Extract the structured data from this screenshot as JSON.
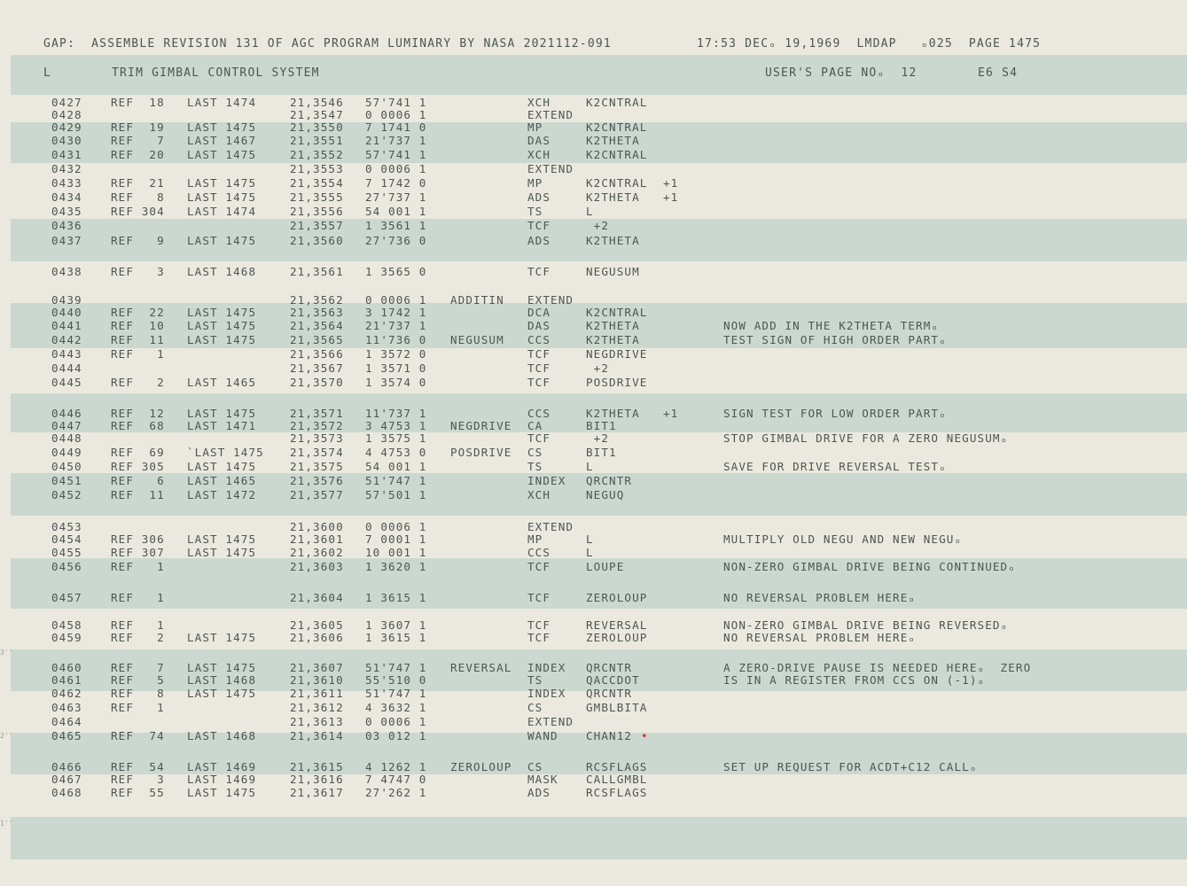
{
  "header": {
    "left": "GAP:  ASSEMBLE REVISION 131 OF AGC PROGRAM LUMINARY BY NASA 2021112-091",
    "right": "17:53 DECₒ 19,1969  LMDAP   ₒ025  PAGE 1475"
  },
  "subheader": {
    "letter": "L",
    "title": "TRIM GIMBAL CONTROL SYSTEM",
    "users_page": "USER'S PAGE NOₒ  12",
    "tag": "E6 S4"
  },
  "rows": [
    {
      "ln": "0427",
      "ref": "REF  18",
      "last": "LAST 1474",
      "addr": "21,3546",
      "oct": "57'741 1",
      "lbl": "",
      "op": "XCH",
      "arg": "K2CNTRAL",
      "mod": "",
      "cmt": ""
    },
    {
      "ln": "0428",
      "ref": "",
      "last": "",
      "addr": "21,3547",
      "oct": "0 0006 1",
      "lbl": "",
      "op": "EXTEND",
      "arg": "",
      "mod": "",
      "cmt": ""
    },
    {
      "ln": "0429",
      "ref": "REF  19",
      "last": "LAST 1475",
      "addr": "21,3550",
      "oct": "7 1741 0",
      "lbl": "",
      "op": "MP",
      "arg": "K2CNTRAL",
      "mod": "",
      "cmt": ""
    },
    {
      "ln": "0430",
      "ref": "REF   7",
      "last": "LAST 1467",
      "addr": "21,3551",
      "oct": "21'737 1",
      "lbl": "",
      "op": "DAS",
      "arg": "K2THETA",
      "mod": "",
      "cmt": ""
    },
    {
      "ln": "0431",
      "ref": "REF  20",
      "last": "LAST 1475",
      "addr": "21,3552",
      "oct": "57'741 1",
      "lbl": "",
      "op": "XCH",
      "arg": "K2CNTRAL",
      "mod": "",
      "cmt": ""
    },
    {
      "ln": "0432",
      "ref": "",
      "last": "",
      "addr": "21,3553",
      "oct": "0 0006 1",
      "lbl": "",
      "op": "EXTEND",
      "arg": "",
      "mod": "",
      "cmt": ""
    },
    {
      "ln": "0433",
      "ref": "REF  21",
      "last": "LAST 1475",
      "addr": "21,3554",
      "oct": "7 1742 0",
      "lbl": "",
      "op": "MP",
      "arg": "K2CNTRAL",
      "mod": "+1",
      "cmt": ""
    },
    {
      "ln": "0434",
      "ref": "REF   8",
      "last": "LAST 1475",
      "addr": "21,3555",
      "oct": "27'737 1",
      "lbl": "",
      "op": "ADS",
      "arg": "K2THETA",
      "mod": "+1",
      "cmt": ""
    },
    {
      "ln": "0435",
      "ref": "REF 304",
      "last": "LAST 1474",
      "addr": "21,3556",
      "oct": "54 001 1",
      "lbl": "",
      "op": "TS",
      "arg": "L",
      "mod": "",
      "cmt": ""
    },
    {
      "ln": "0436",
      "ref": "",
      "last": "",
      "addr": "21,3557",
      "oct": "1 3561 1",
      "lbl": "",
      "op": "TCF",
      "arg": " +2",
      "mod": "",
      "cmt": ""
    },
    {
      "ln": "0437",
      "ref": "REF   9",
      "last": "LAST 1475",
      "addr": "21,3560",
      "oct": "27'736 0",
      "lbl": "",
      "op": "ADS",
      "arg": "K2THETA",
      "mod": "",
      "cmt": ""
    },
    {
      "ln": "0438",
      "ref": "REF   3",
      "last": "LAST 1468",
      "addr": "21,3561",
      "oct": "1 3565 0",
      "lbl": "",
      "op": "TCF",
      "arg": "NEGUSUM",
      "mod": "",
      "cmt": ""
    },
    {
      "ln": "0439",
      "ref": "",
      "last": "",
      "addr": "21,3562",
      "oct": "0 0006 1",
      "lbl": "ADDITIN",
      "op": "EXTEND",
      "arg": "",
      "mod": "",
      "cmt": ""
    },
    {
      "ln": "0440",
      "ref": "REF  22",
      "last": "LAST 1475",
      "addr": "21,3563",
      "oct": "3 1742 1",
      "lbl": "",
      "op": "DCA",
      "arg": "K2CNTRAL",
      "mod": "",
      "cmt": ""
    },
    {
      "ln": "0441",
      "ref": "REF  10",
      "last": "LAST 1475",
      "addr": "21,3564",
      "oct": "21'737 1",
      "lbl": "",
      "op": "DAS",
      "arg": "K2THETA",
      "mod": "",
      "cmt": "NOW ADD IN THE K2THETA TERMₒ"
    },
    {
      "ln": "0442",
      "ref": "REF  11",
      "last": "LAST 1475",
      "addr": "21,3565",
      "oct": "11'736 0",
      "lbl": "NEGUSUM",
      "op": "CCS",
      "arg": "K2THETA",
      "mod": "",
      "cmt": "TEST SIGN OF HIGH ORDER PARTₒ"
    },
    {
      "ln": "0443",
      "ref": "REF   1",
      "last": "",
      "addr": "21,3566",
      "oct": "1 3572 0",
      "lbl": "",
      "op": "TCF",
      "arg": "NEGDRIVE",
      "mod": "",
      "cmt": ""
    },
    {
      "ln": "0444",
      "ref": "",
      "last": "",
      "addr": "21,3567",
      "oct": "1 3571 0",
      "lbl": "",
      "op": "TCF",
      "arg": " +2",
      "mod": "",
      "cmt": ""
    },
    {
      "ln": "0445",
      "ref": "REF   2",
      "last": "LAST 1465",
      "addr": "21,3570",
      "oct": "1 3574 0",
      "lbl": "",
      "op": "TCF",
      "arg": "POSDRIVE",
      "mod": "",
      "cmt": ""
    },
    {
      "ln": "0446",
      "ref": "REF  12",
      "last": "LAST 1475",
      "addr": "21,3571",
      "oct": "11'737 1",
      "lbl": "",
      "op": "CCS",
      "arg": "K2THETA",
      "mod": "+1",
      "cmt": "SIGN TEST FOR LOW ORDER PARTₒ"
    },
    {
      "ln": "0447",
      "ref": "REF  68",
      "last": "LAST 1471",
      "addr": "21,3572",
      "oct": "3 4753 1",
      "lbl": "NEGDRIVE",
      "op": "CA",
      "arg": "BIT1",
      "mod": "",
      "cmt": ""
    },
    {
      "ln": "0448",
      "ref": "",
      "last": "",
      "addr": "21,3573",
      "oct": "1 3575 1",
      "lbl": "",
      "op": "TCF",
      "arg": " +2",
      "mod": "",
      "cmt": "STOP GIMBAL DRIVE FOR A ZERO NEGUSUMₒ"
    },
    {
      "ln": "0449",
      "ref": "REF  69",
      "last": "`LAST 1475",
      "addr": "21,3574",
      "oct": "4 4753 0",
      "lbl": "POSDRIVE",
      "op": "CS",
      "arg": "BIT1",
      "mod": "",
      "cmt": ""
    },
    {
      "ln": "0450",
      "ref": "REF 305",
      "last": "LAST 1475",
      "addr": "21,3575",
      "oct": "54 001 1",
      "lbl": "",
      "op": "TS",
      "arg": "L",
      "mod": "",
      "cmt": "SAVE FOR DRIVE REVERSAL TESTₒ"
    },
    {
      "ln": "0451",
      "ref": "REF   6",
      "last": "LAST 1465",
      "addr": "21,3576",
      "oct": "51'747 1",
      "lbl": "",
      "op": "INDEX",
      "arg": "QRCNTR",
      "mod": "",
      "cmt": ""
    },
    {
      "ln": "0452",
      "ref": "REF  11",
      "last": "LAST 1472",
      "addr": "21,3577",
      "oct": "57'501 1",
      "lbl": "",
      "op": "XCH",
      "arg": "NEGUQ",
      "mod": "",
      "cmt": ""
    },
    {
      "ln": "0453",
      "ref": "",
      "last": "",
      "addr": "21,3600",
      "oct": "0 0006 1",
      "lbl": "",
      "op": "EXTEND",
      "arg": "",
      "mod": "",
      "cmt": ""
    },
    {
      "ln": "0454",
      "ref": "REF 306",
      "last": "LAST 1475",
      "addr": "21,3601",
      "oct": "7 0001 1",
      "lbl": "",
      "op": "MP",
      "arg": "L",
      "mod": "",
      "cmt": "MULTIPLY OLD NEGU AND NEW NEGUₒ"
    },
    {
      "ln": "0455",
      "ref": "REF 307",
      "last": "LAST 1475",
      "addr": "21,3602",
      "oct": "10 001 1",
      "lbl": "",
      "op": "CCS",
      "arg": "L",
      "mod": "",
      "cmt": ""
    },
    {
      "ln": "0456",
      "ref": "REF   1",
      "last": "",
      "addr": "21,3603",
      "oct": "1 3620 1",
      "lbl": "",
      "op": "TCF",
      "arg": "LOUPE",
      "mod": "",
      "cmt": "NON-ZERO GIMBAL DRIVE BEING CONTINUEDₒ"
    },
    {
      "ln": "0457",
      "ref": "REF   1",
      "last": "",
      "addr": "21,3604",
      "oct": "1 3615 1",
      "lbl": "",
      "op": "TCF",
      "arg": "ZEROLOUP",
      "mod": "",
      "cmt": "NO REVERSAL PROBLEM HEREₒ"
    },
    {
      "ln": "0458",
      "ref": "REF   1",
      "last": "",
      "addr": "21,3605",
      "oct": "1 3607 1",
      "lbl": "",
      "op": "TCF",
      "arg": "REVERSAL",
      "mod": "",
      "cmt": "NON-ZERO GIMBAL DRIVE BEING REVERSEDₒ"
    },
    {
      "ln": "0459",
      "ref": "REF   2",
      "last": "LAST 1475",
      "addr": "21,3606",
      "oct": "1 3615 1",
      "lbl": "",
      "op": "TCF",
      "arg": "ZEROLOUP",
      "mod": "",
      "cmt": "NO REVERSAL PROBLEM HEREₒ"
    },
    {
      "ln": "0460",
      "ref": "REF   7",
      "last": "LAST 1475",
      "addr": "21,3607",
      "oct": "51'747 1",
      "lbl": "REVERSAL",
      "op": "INDEX",
      "arg": "QRCNTR",
      "mod": "",
      "cmt": "A ZERO-DRIVE PAUSE IS NEEDED HEREₒ  ZERO"
    },
    {
      "ln": "0461",
      "ref": "REF   5",
      "last": "LAST 1468",
      "addr": "21,3610",
      "oct": "55'510 0",
      "lbl": "",
      "op": "TS",
      "arg": "QACCDOT",
      "mod": "",
      "cmt": "IS IN A REGISTER FROM CCS ON (-1)ₒ"
    },
    {
      "ln": "0462",
      "ref": "REF   8",
      "last": "LAST 1475",
      "addr": "21,3611",
      "oct": "51'747 1",
      "lbl": "",
      "op": "INDEX",
      "arg": "QRCNTR",
      "mod": "",
      "cmt": ""
    },
    {
      "ln": "0463",
      "ref": "REF   1",
      "last": "",
      "addr": "21,3612",
      "oct": "4 3632 1",
      "lbl": "",
      "op": "CS",
      "arg": "GMBLBITA",
      "mod": "",
      "cmt": ""
    },
    {
      "ln": "0464",
      "ref": "",
      "last": "",
      "addr": "21,3613",
      "oct": "0 0006 1",
      "lbl": "",
      "op": "EXTEND",
      "arg": "",
      "mod": "",
      "cmt": ""
    },
    {
      "ln": "0465",
      "ref": "REF  74",
      "last": "LAST 1468",
      "addr": "21,3614",
      "oct": "03 012 1",
      "lbl": "",
      "op": "WAND",
      "arg": "CHAN12",
      "mod": "",
      "cmt": ""
    },
    {
      "ln": "0466",
      "ref": "REF  54",
      "last": "LAST 1469",
      "addr": "21,3615",
      "oct": "4 1262 1",
      "lbl": "ZEROLOUP",
      "op": "CS",
      "arg": "RCSFLAGS",
      "mod": "",
      "cmt": "SET UP REQUEST FOR ACDT+C12 CALLₒ"
    },
    {
      "ln": "0467",
      "ref": "REF   3",
      "last": "LAST 1469",
      "addr": "21,3616",
      "oct": "7 4747 0",
      "lbl": "",
      "op": "MASK",
      "arg": "CALLGMBL",
      "mod": "",
      "cmt": ""
    },
    {
      "ln": "0468",
      "ref": "REF  55",
      "last": "LAST 1475",
      "addr": "21,3617",
      "oct": "27'262 1",
      "lbl": "",
      "op": "ADS",
      "arg": "RCSFLAGS",
      "mod": "",
      "cmt": ""
    }
  ],
  "margin_marks": [
    "3''",
    "2''",
    "1''"
  ],
  "colors": {
    "paper": "#ebe9df",
    "band": "#cbd8cf",
    "ink": "#4d5552",
    "mark": "#d6313a"
  }
}
